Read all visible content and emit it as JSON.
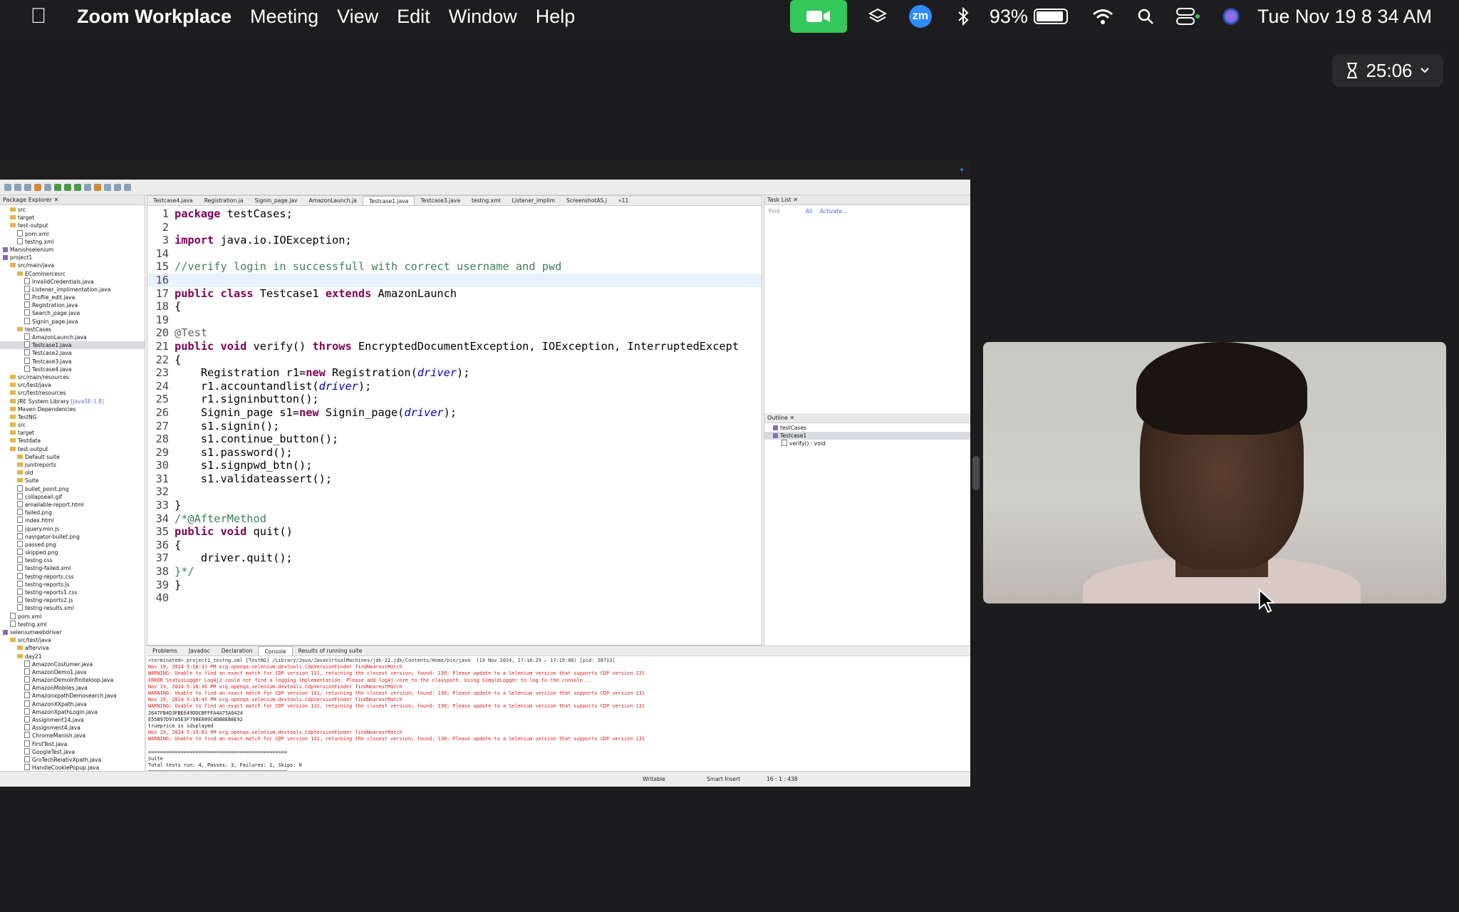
{
  "menubar": {
    "app": "Zoom Workplace",
    "items": [
      "Meeting",
      "View",
      "Edit",
      "Window",
      "Help"
    ],
    "battery": "93%",
    "battery_level": 0.93,
    "clock": "Tue Nov 19  8 34 AM",
    "zm": "zm"
  },
  "timer": {
    "value": "25:06"
  },
  "eclipse": {
    "package_explorer_title": "Package Explorer",
    "tree": [
      {
        "t": "src",
        "k": "f",
        "i": 14
      },
      {
        "t": "target",
        "k": "f",
        "i": 14
      },
      {
        "t": "test-output",
        "k": "f",
        "i": 14
      },
      {
        "t": "pom.xml",
        "k": "j",
        "i": 24
      },
      {
        "t": "testng.xml",
        "k": "j",
        "i": 24
      },
      {
        "t": "Manishselenium",
        "k": "p",
        "i": 4
      },
      {
        "t": "project1",
        "k": "p",
        "i": 4
      },
      {
        "t": "src/main/java",
        "k": "f",
        "i": 14
      },
      {
        "t": "ECommercesrc",
        "k": "f",
        "i": 24
      },
      {
        "t": "InvalidCredentials.java",
        "k": "j",
        "i": 34
      },
      {
        "t": "Listener_implimentation.java",
        "k": "j",
        "i": 34
      },
      {
        "t": "Profile_edit.java",
        "k": "j",
        "i": 34
      },
      {
        "t": "Registration.java",
        "k": "j",
        "i": 34
      },
      {
        "t": "Search_page.java",
        "k": "j",
        "i": 34
      },
      {
        "t": "Signin_page.java",
        "k": "j",
        "i": 34
      },
      {
        "t": "testCases",
        "k": "f",
        "i": 24
      },
      {
        "t": "AmazonLaunch.java",
        "k": "j",
        "i": 34
      },
      {
        "t": "Testcase1.java",
        "k": "j",
        "i": 34,
        "sel": true
      },
      {
        "t": "Testcase2.java",
        "k": "j",
        "i": 34
      },
      {
        "t": "Testcase3.java",
        "k": "j",
        "i": 34
      },
      {
        "t": "Testcase4.java",
        "k": "j",
        "i": 34
      },
      {
        "t": "src/main/resources",
        "k": "f",
        "i": 14
      },
      {
        "t": "src/test/java",
        "k": "f",
        "i": 14
      },
      {
        "t": "src/test/resources",
        "k": "f",
        "i": 14
      },
      {
        "t": "JRE System Library",
        "k": "f",
        "i": 14,
        "extra": "[JavaSE-1.8]"
      },
      {
        "t": "Maven Dependencies",
        "k": "f",
        "i": 14
      },
      {
        "t": "TestNG",
        "k": "f",
        "i": 14
      },
      {
        "t": "src",
        "k": "f",
        "i": 14
      },
      {
        "t": "target",
        "k": "f",
        "i": 14
      },
      {
        "t": "Testdata",
        "k": "f",
        "i": 14
      },
      {
        "t": "test-output",
        "k": "f",
        "i": 14
      },
      {
        "t": "Default suite",
        "k": "f",
        "i": 24
      },
      {
        "t": "junitreports",
        "k": "f",
        "i": 24
      },
      {
        "t": "old",
        "k": "f",
        "i": 24
      },
      {
        "t": "Suite",
        "k": "f",
        "i": 24
      },
      {
        "t": "bullet_point.png",
        "k": "j",
        "i": 24
      },
      {
        "t": "collapseall.gif",
        "k": "j",
        "i": 24
      },
      {
        "t": "emailable-report.html",
        "k": "j",
        "i": 24
      },
      {
        "t": "failed.png",
        "k": "j",
        "i": 24
      },
      {
        "t": "index.html",
        "k": "j",
        "i": 24
      },
      {
        "t": "jquery.min.js",
        "k": "j",
        "i": 24
      },
      {
        "t": "navigator-bullet.png",
        "k": "j",
        "i": 24
      },
      {
        "t": "passed.png",
        "k": "j",
        "i": 24
      },
      {
        "t": "skipped.png",
        "k": "j",
        "i": 24
      },
      {
        "t": "testng.css",
        "k": "j",
        "i": 24
      },
      {
        "t": "testng-failed.xml",
        "k": "j",
        "i": 24
      },
      {
        "t": "testng-reports.css",
        "k": "j",
        "i": 24
      },
      {
        "t": "testng-reports.js",
        "k": "j",
        "i": 24
      },
      {
        "t": "testng-reports1.css",
        "k": "j",
        "i": 24
      },
      {
        "t": "testng-reports2.js",
        "k": "j",
        "i": 24
      },
      {
        "t": "testng-results.xml",
        "k": "j",
        "i": 24
      },
      {
        "t": "pom.xml",
        "k": "j",
        "i": 14
      },
      {
        "t": "testng.xml",
        "k": "j",
        "i": 14
      },
      {
        "t": "seleniumwebdriver",
        "k": "p",
        "i": 4
      },
      {
        "t": "src/test/java",
        "k": "f",
        "i": 14
      },
      {
        "t": "afterviva",
        "k": "f",
        "i": 24
      },
      {
        "t": "day21",
        "k": "f",
        "i": 24
      },
      {
        "t": "AmazonCostumer.java",
        "k": "j",
        "i": 34
      },
      {
        "t": "AmazonDemo1.java",
        "k": "j",
        "i": 34
      },
      {
        "t": "AmazonDemoInfiniteloop.java",
        "k": "j",
        "i": 34
      },
      {
        "t": "AmazonMobiles.java",
        "k": "j",
        "i": 34
      },
      {
        "t": "AmazonxpathDemosearch.java",
        "k": "j",
        "i": 34
      },
      {
        "t": "AmazonXXpath.java",
        "k": "j",
        "i": 34
      },
      {
        "t": "AmazonXpathLogin.java",
        "k": "j",
        "i": 34
      },
      {
        "t": "Assignment14.java",
        "k": "j",
        "i": 34
      },
      {
        "t": "Assignment4.java",
        "k": "j",
        "i": 34
      },
      {
        "t": "ChromeManish.java",
        "k": "j",
        "i": 34
      },
      {
        "t": "FirstTest.java",
        "k": "j",
        "i": 34
      },
      {
        "t": "GoogleTest.java",
        "k": "j",
        "i": 34
      },
      {
        "t": "GroTechRelativXpath.java",
        "k": "j",
        "i": 34
      },
      {
        "t": "HandleCookiePopup.java",
        "k": "j",
        "i": 34
      }
    ],
    "tabs": [
      "Testcase4.java",
      "Registration.ja",
      "Signin_page.jav",
      "AmazonLaunch.ja",
      "Testcase1.java",
      "Testcase3.java",
      "testng.xml",
      "Listener_implim",
      "ScreenshotAS.j",
      "»11"
    ],
    "active_tab": "Testcase1.java",
    "code": [
      {
        "n": "1",
        "t": "package testCases;"
      },
      {
        "n": "2",
        "t": ""
      },
      {
        "n": "3",
        "t": "import java.io.IOException;"
      },
      {
        "n": "14",
        "t": ""
      },
      {
        "n": "15",
        "t": "//verify login in successfull with correct username and pwd"
      },
      {
        "n": "16",
        "t": ""
      },
      {
        "n": "17",
        "t": "public class Testcase1 extends AmazonLaunch"
      },
      {
        "n": "18",
        "t": "{"
      },
      {
        "n": "19",
        "t": ""
      },
      {
        "n": "20",
        "t": "@Test"
      },
      {
        "n": "21",
        "t": "public void verify() throws EncryptedDocumentException, IOException, InterruptedExcept"
      },
      {
        "n": "22",
        "t": "{"
      },
      {
        "n": "23",
        "t": "    Registration r1=new Registration(driver);"
      },
      {
        "n": "24",
        "t": "    r1.accountandlist(driver);"
      },
      {
        "n": "25",
        "t": "    r1.signinbutton();"
      },
      {
        "n": "26",
        "t": "    Signin_page s1=new Signin_page(driver);"
      },
      {
        "n": "27",
        "t": "    s1.signin();"
      },
      {
        "n": "28",
        "t": "    s1.continue_button();"
      },
      {
        "n": "29",
        "t": "    s1.password();"
      },
      {
        "n": "30",
        "t": "    s1.signpwd_btn();"
      },
      {
        "n": "31",
        "t": "    s1.validateassert();"
      },
      {
        "n": "32",
        "t": ""
      },
      {
        "n": "33",
        "t": "}"
      },
      {
        "n": "34",
        "t": "/*@AfterMethod"
      },
      {
        "n": "35",
        "t": "public void quit()"
      },
      {
        "n": "36",
        "t": "{"
      },
      {
        "n": "37",
        "t": "    driver.quit();"
      },
      {
        "n": "38",
        "t": "}*/"
      },
      {
        "n": "39",
        "t": "}"
      },
      {
        "n": "40",
        "t": ""
      }
    ],
    "task_list_title": "Task List",
    "find_placeholder": "Find",
    "find_all": "All",
    "find_activate": "Activate...",
    "outline_title": "Outline",
    "outline": [
      "testCases",
      "Testcase1",
      "verify() : void"
    ],
    "console_tabs": [
      "Problems",
      "Javadoc",
      "Declaration",
      "Console",
      "Results of running suite"
    ],
    "console": [
      {
        "c": "g",
        "t": "<terminated> project1_testng.xml [TestNG] /Library/Java/JavaVirtualMachines/jdk-22.jdk/Contents/Home/bin/java  (19 Nov 2024, 17:18:29 – 17:19:08) [pid: 58713]"
      },
      {
        "c": "r",
        "t": "Nov 19, 2024 5:18:31 PM org.openqa.selenium.devtools.CdpVersionFinder findNearestMatch"
      },
      {
        "c": "r",
        "t": "WARNING: Unable to find an exact match for CDP version 131, returning the closest version; found: 130; Please update to a Selenium version that supports CDP version 131"
      },
      {
        "c": "r",
        "t": "ERROR StatusLogger Log4j2 could not find a logging implementation. Please add log4j-core to the classpath. Using SimpleLogger to log to the console..."
      },
      {
        "c": "r",
        "t": "Nov 19, 2024 5:18:36 PM org.openqa.selenium.devtools.CdpVersionFinder findNearestMatch"
      },
      {
        "c": "r",
        "t": "WARNING: Unable to find an exact match for CDP version 131, returning the closest version; found: 130; Please update to a Selenium version that supports CDP version 131"
      },
      {
        "c": "r",
        "t": "Nov 19, 2024 5:18:45 PM org.openqa.selenium.devtools.CdpVersionFinder findNearestMatch"
      },
      {
        "c": "r",
        "t": "WARNING: Unable to find an exact match for CDP version 131, returning the closest version; found: 130; Please update to a Selenium version that supports CDP version 131"
      },
      {
        "c": "k",
        "t": "2647FB4D3FBE649DDCBFFFA4A75A0424"
      },
      {
        "c": "k",
        "t": "E55B97D97A5E3F790E089C8DB8EB8E92"
      },
      {
        "c": "k",
        "t": "trueprice is idsplayed"
      },
      {
        "c": "r",
        "t": "Nov 19, 2024 5:19:01 PM org.openqa.selenium.devtools.CdpVersionFinder findNearestMatch"
      },
      {
        "c": "r",
        "t": "WARNING: Unable to find an exact match for CDP version 131, returning the closest version; found: 130; Please update to a Selenium version that supports CDP version 131"
      },
      {
        "c": "k",
        "t": ""
      },
      {
        "c": "k",
        "t": "==============================================="
      },
      {
        "c": "k",
        "t": "Suite"
      },
      {
        "c": "k",
        "t": "Total tests run: 4, Passes: 3, Failures: 1, Skips: 0"
      },
      {
        "c": "k",
        "t": "==============================================="
      }
    ],
    "status": {
      "writable": "Writable",
      "insert": "Smart Insert",
      "position": "16 : 1 : 438"
    }
  },
  "colors": {
    "zoom_green": "#34c759",
    "keyword": "#7f0055",
    "comment": "#3f7f5f",
    "console_error": "#d81e1e"
  }
}
